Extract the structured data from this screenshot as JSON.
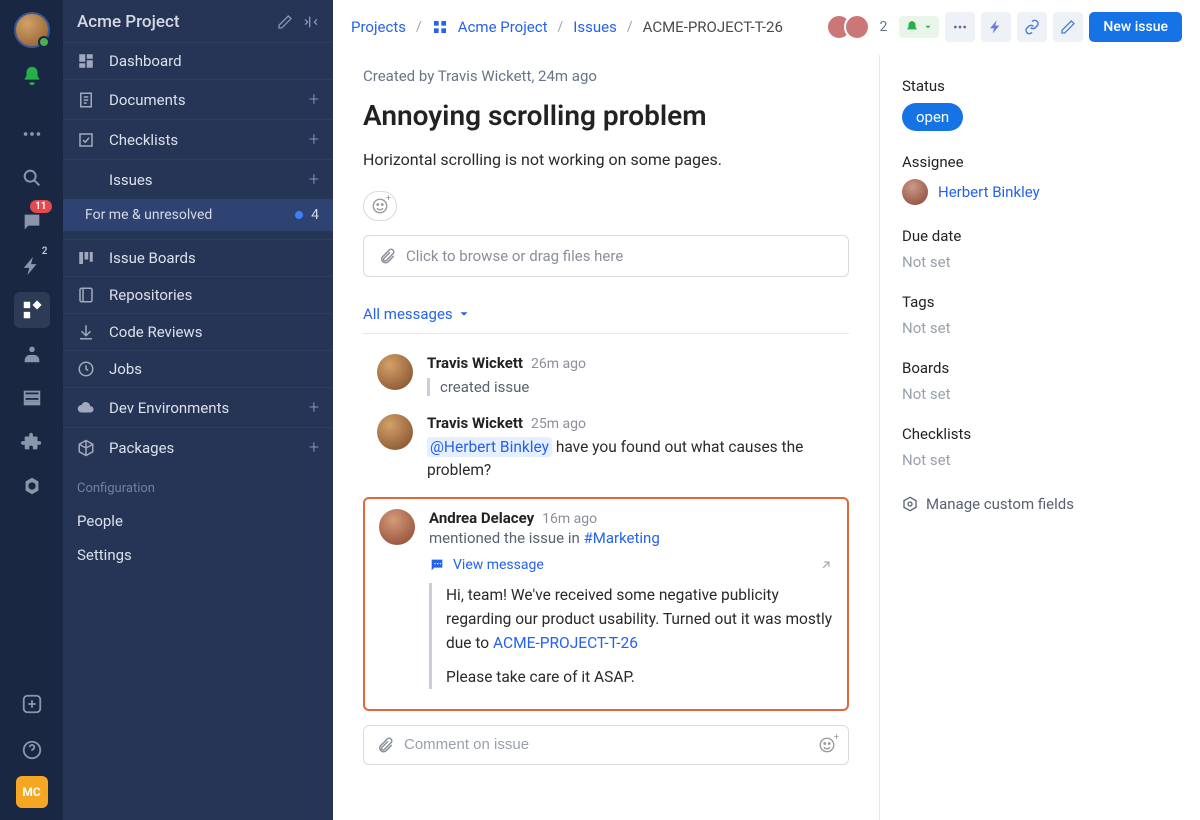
{
  "rail": {
    "chat_badge": "11",
    "bolt_sup": "2",
    "bottom_chip": "MC"
  },
  "sidebar": {
    "title": "Acme Project",
    "items": [
      {
        "label": "Dashboard",
        "plus": false
      },
      {
        "label": "Documents",
        "plus": true
      },
      {
        "label": "Checklists",
        "plus": true
      },
      {
        "label": "Issues",
        "plus": true
      }
    ],
    "sub": {
      "label": "For me & unresolved",
      "count": "4"
    },
    "items2": [
      {
        "label": "Issue Boards",
        "plus": false
      },
      {
        "label": "Repositories",
        "plus": false
      },
      {
        "label": "Code Reviews",
        "plus": false
      },
      {
        "label": "Jobs",
        "plus": false
      },
      {
        "label": "Dev Environments",
        "plus": true
      },
      {
        "label": "Packages",
        "plus": true
      }
    ],
    "config_label": "Configuration",
    "config_items": [
      "People",
      "Settings"
    ]
  },
  "breadcrumb": {
    "root": "Projects",
    "project": "Acme Project",
    "section": "Issues",
    "current": "ACME-PROJECT-T-26"
  },
  "topbar": {
    "watcher_count": "2",
    "new_issue": "New issue"
  },
  "issue": {
    "created_line": "Created by Travis Wickett, 24m ago",
    "title": "Annoying scrolling problem",
    "desc": "Horizontal scrolling is not working on some pages.",
    "dropzone": "Click to browse or drag files here",
    "filter": "All messages"
  },
  "messages": [
    {
      "author": "Travis Wickett",
      "time": "26m ago",
      "system": "created issue"
    },
    {
      "author": "Travis Wickett",
      "time": "25m ago",
      "mention": "@Herbert Binkley",
      "text_after": " have you found out what causes the problem?"
    },
    {
      "author": "Andrea Delacey",
      "time": "16m ago",
      "action_pre": "mentioned the issue in ",
      "channel": "#Marketing",
      "view_label": "View message",
      "quote_p1_pre": "Hi, team! We've received some negative publicity regarding our product usability. Turned out it was mostly due to ",
      "quote_link": "ACME-PROJECT-T-26",
      "quote_p2": "Please take care of it ASAP."
    }
  ],
  "composer": {
    "placeholder": "Comment on issue"
  },
  "panel": {
    "status_label": "Status",
    "status_value": "open",
    "assignee_label": "Assignee",
    "assignee_value": "Herbert Binkley",
    "due_label": "Due date",
    "tags_label": "Tags",
    "boards_label": "Boards",
    "checklists_label": "Checklists",
    "not_set": "Not set",
    "custom": "Manage custom fields"
  }
}
